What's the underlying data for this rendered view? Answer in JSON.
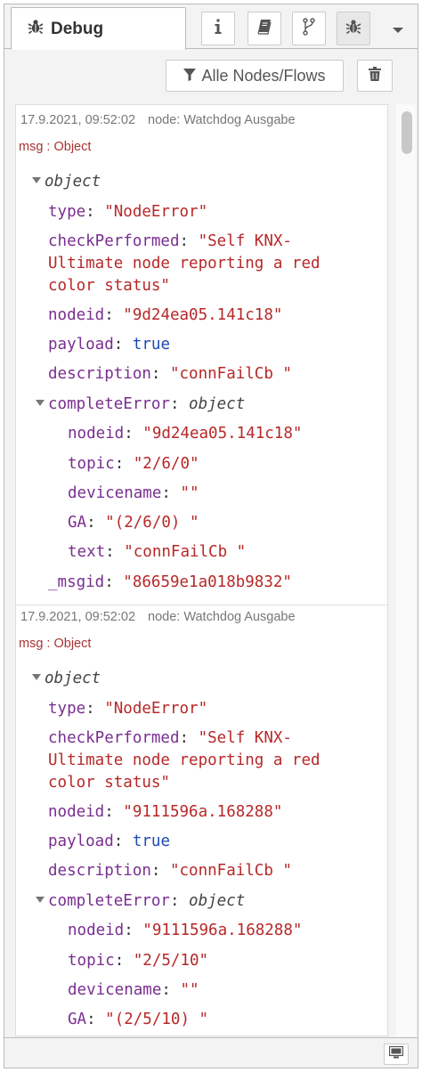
{
  "header": {
    "active_tab_label": "Debug",
    "tab_icon": "bug-icon",
    "buttons": [
      "info-icon",
      "book-icon",
      "branch-icon",
      "bug-icon"
    ],
    "menu_icon": "caret-down-icon"
  },
  "toolbar": {
    "filter_label": "Alle Nodes/Flows",
    "clear_icon": "trash-icon"
  },
  "messages": [
    {
      "timestamp": "17.9.2021, 09:52:02",
      "node": "node: Watchdog Ausgabe",
      "msgtype": "msg : Object",
      "root_label": "object",
      "type_key": "type",
      "type_value": "\"NodeError\"",
      "check_key": "checkPerformed",
      "check_value_1": "\"Self KNX-",
      "check_value_2": "Ultimate node reporting a red",
      "check_value_3": "color status\"",
      "nodeid_key": "nodeid",
      "nodeid_value": "\"9d24ea05.141c18\"",
      "payload_key": "payload",
      "payload_value": "true",
      "desc_key": "description",
      "desc_value": "\"connFailCb \"",
      "ce_key": "completeError",
      "ce_type": "object",
      "ce_nodeid_key": "nodeid",
      "ce_nodeid_value": "\"9d24ea05.141c18\"",
      "ce_topic_key": "topic",
      "ce_topic_value": "\"2/6/0\"",
      "ce_devicename_key": "devicename",
      "ce_devicename_value": "\"\"",
      "ce_ga_key": "GA",
      "ce_ga_value": "\"(2/6/0) \"",
      "ce_text_key": "text",
      "ce_text_value": "\"connFailCb \"",
      "msgid_key": "_msgid",
      "msgid_value": "\"86659e1a018b9832\""
    },
    {
      "timestamp": "17.9.2021, 09:52:02",
      "node": "node: Watchdog Ausgabe",
      "msgtype": "msg : Object",
      "root_label": "object",
      "type_key": "type",
      "type_value": "\"NodeError\"",
      "check_key": "checkPerformed",
      "check_value_1": "\"Self KNX-",
      "check_value_2": "Ultimate node reporting a red",
      "check_value_3": "color status\"",
      "nodeid_key": "nodeid",
      "nodeid_value": "\"9111596a.168288\"",
      "payload_key": "payload",
      "payload_value": "true",
      "desc_key": "description",
      "desc_value": "\"connFailCb \"",
      "ce_key": "completeError",
      "ce_type": "object",
      "ce_nodeid_key": "nodeid",
      "ce_nodeid_value": "\"9111596a.168288\"",
      "ce_topic_key": "topic",
      "ce_topic_value": "\"2/5/10\"",
      "ce_devicename_key": "devicename",
      "ce_devicename_value": "\"\"",
      "ce_ga_key": "GA",
      "ce_ga_value": "\"(2/5/10) \""
    }
  ],
  "footer": {
    "popout_icon": "monitor-icon"
  },
  "colors": {
    "key": "#792e90",
    "string": "#b72828",
    "boolean": "#1f49b3",
    "msgtype": "#aa3333"
  }
}
